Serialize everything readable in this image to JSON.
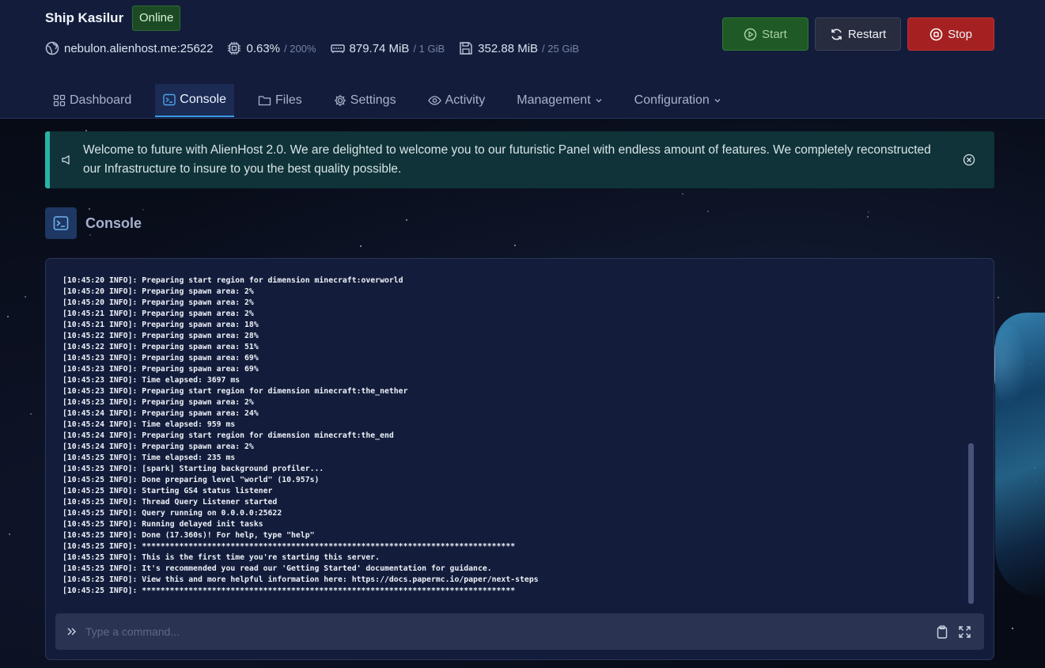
{
  "server": {
    "name": "Ship Kasilur",
    "status": "Online",
    "address": "nebulon.alienhost.me:25622",
    "cpu": "0.63%",
    "cpu_limit": "/ 200%",
    "memory": "879.74 MiB",
    "memory_limit": "/ 1 GiB",
    "disk": "352.88 MiB",
    "disk_limit": "/ 25 GiB"
  },
  "actions": {
    "start": "Start",
    "restart": "Restart",
    "stop": "Stop"
  },
  "tabs": [
    {
      "label": "Dashboard",
      "icon": "grid-icon"
    },
    {
      "label": "Console",
      "icon": "terminal-icon",
      "active": true
    },
    {
      "label": "Files",
      "icon": "folder-icon"
    },
    {
      "label": "Settings",
      "icon": "gear-icon"
    },
    {
      "label": "Activity",
      "icon": "eye-icon"
    },
    {
      "label": "Management",
      "icon": "chevron-down-icon"
    },
    {
      "label": "Configuration",
      "icon": "chevron-down-icon"
    }
  ],
  "alert": {
    "text": "Welcome to future with AlienHost 2.0. We are delighted to welcome you to our futuristic Panel with endless amount of features. We completely reconstructed our Infrastructure to insure to you the best quality possible."
  },
  "console": {
    "title": "Console",
    "placeholder": "Type a command...",
    "lines": [
      "[10:45:20 INFO]: Preparing start region for dimension minecraft:overworld",
      "[10:45:20 INFO]: Preparing spawn area: 2%",
      "[10:45:20 INFO]: Preparing spawn area: 2%",
      "[10:45:21 INFO]: Preparing spawn area: 2%",
      "[10:45:21 INFO]: Preparing spawn area: 18%",
      "[10:45:22 INFO]: Preparing spawn area: 28%",
      "[10:45:22 INFO]: Preparing spawn area: 51%",
      "[10:45:23 INFO]: Preparing spawn area: 69%",
      "[10:45:23 INFO]: Preparing spawn area: 69%",
      "[10:45:23 INFO]: Time elapsed: 3697 ms",
      "[10:45:23 INFO]: Preparing start region for dimension minecraft:the_nether",
      "[10:45:23 INFO]: Preparing spawn area: 2%",
      "[10:45:24 INFO]: Preparing spawn area: 24%",
      "[10:45:24 INFO]: Time elapsed: 959 ms",
      "[10:45:24 INFO]: Preparing start region for dimension minecraft:the_end",
      "[10:45:24 INFO]: Preparing spawn area: 2%",
      "[10:45:25 INFO]: Time elapsed: 235 ms",
      "[10:45:25 INFO]: [spark] Starting background profiler...",
      "[10:45:25 INFO]: Done preparing level \"world\" (10.957s)",
      "[10:45:25 INFO]: Starting GS4 status listener",
      "[10:45:25 INFO]: Thread Query Listener started",
      "[10:45:25 INFO]: Query running on 0.0.0.0:25622",
      "[10:45:25 INFO]: Running delayed init tasks",
      "[10:45:25 INFO]: Done (17.360s)! For help, type \"help\"",
      "[10:45:25 INFO]: ********************************************************************************",
      "[10:45:25 INFO]: This is the first time you're starting this server.",
      "[10:45:25 INFO]: It's recommended you read our 'Getting Started' documentation for guidance.",
      "[10:45:25 INFO]: View this and more helpful information here: https://docs.papermc.io/paper/next-steps",
      "[10:45:25 INFO]: ********************************************************************************"
    ]
  },
  "colors": {
    "header_bg": "#131d3b",
    "online_badge": "#1c4a25",
    "start_btn": "#1f5a26",
    "stop_btn": "#a52121",
    "accent": "#3b9be6",
    "alert_border": "#27b3a5"
  }
}
